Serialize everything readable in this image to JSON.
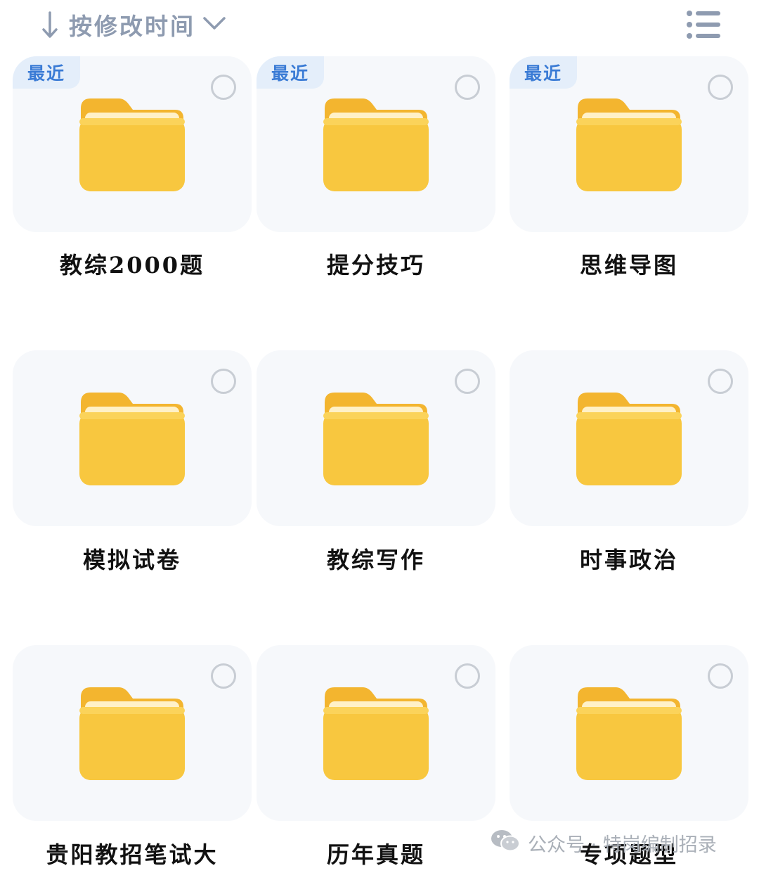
{
  "toolbar": {
    "sort_label": "按修改时间",
    "sort_direction_icon": "arrow-down-icon",
    "sort_menu_icon": "chevron-down-icon",
    "view_icon": "list-view-icon"
  },
  "colors": {
    "folder": "#f8c73f",
    "badge_text": "#3a7bd5",
    "card_bg": "#f6f8fb",
    "sort_text": "#8e9bb0"
  },
  "folders": [
    {
      "name": "教综2000题",
      "badge": "最近"
    },
    {
      "name": "提分技巧",
      "badge": "最近"
    },
    {
      "name": "思维导图",
      "badge": "最近"
    },
    {
      "name": "模拟试卷"
    },
    {
      "name": "教综写作"
    },
    {
      "name": "时事政治"
    },
    {
      "name": "贵阳教招笔试大"
    },
    {
      "name": "历年真题"
    },
    {
      "name": "专项题型"
    }
  ],
  "watermark": {
    "text": "公众号 · 特岗编制招录",
    "icon": "wechat-icon"
  }
}
